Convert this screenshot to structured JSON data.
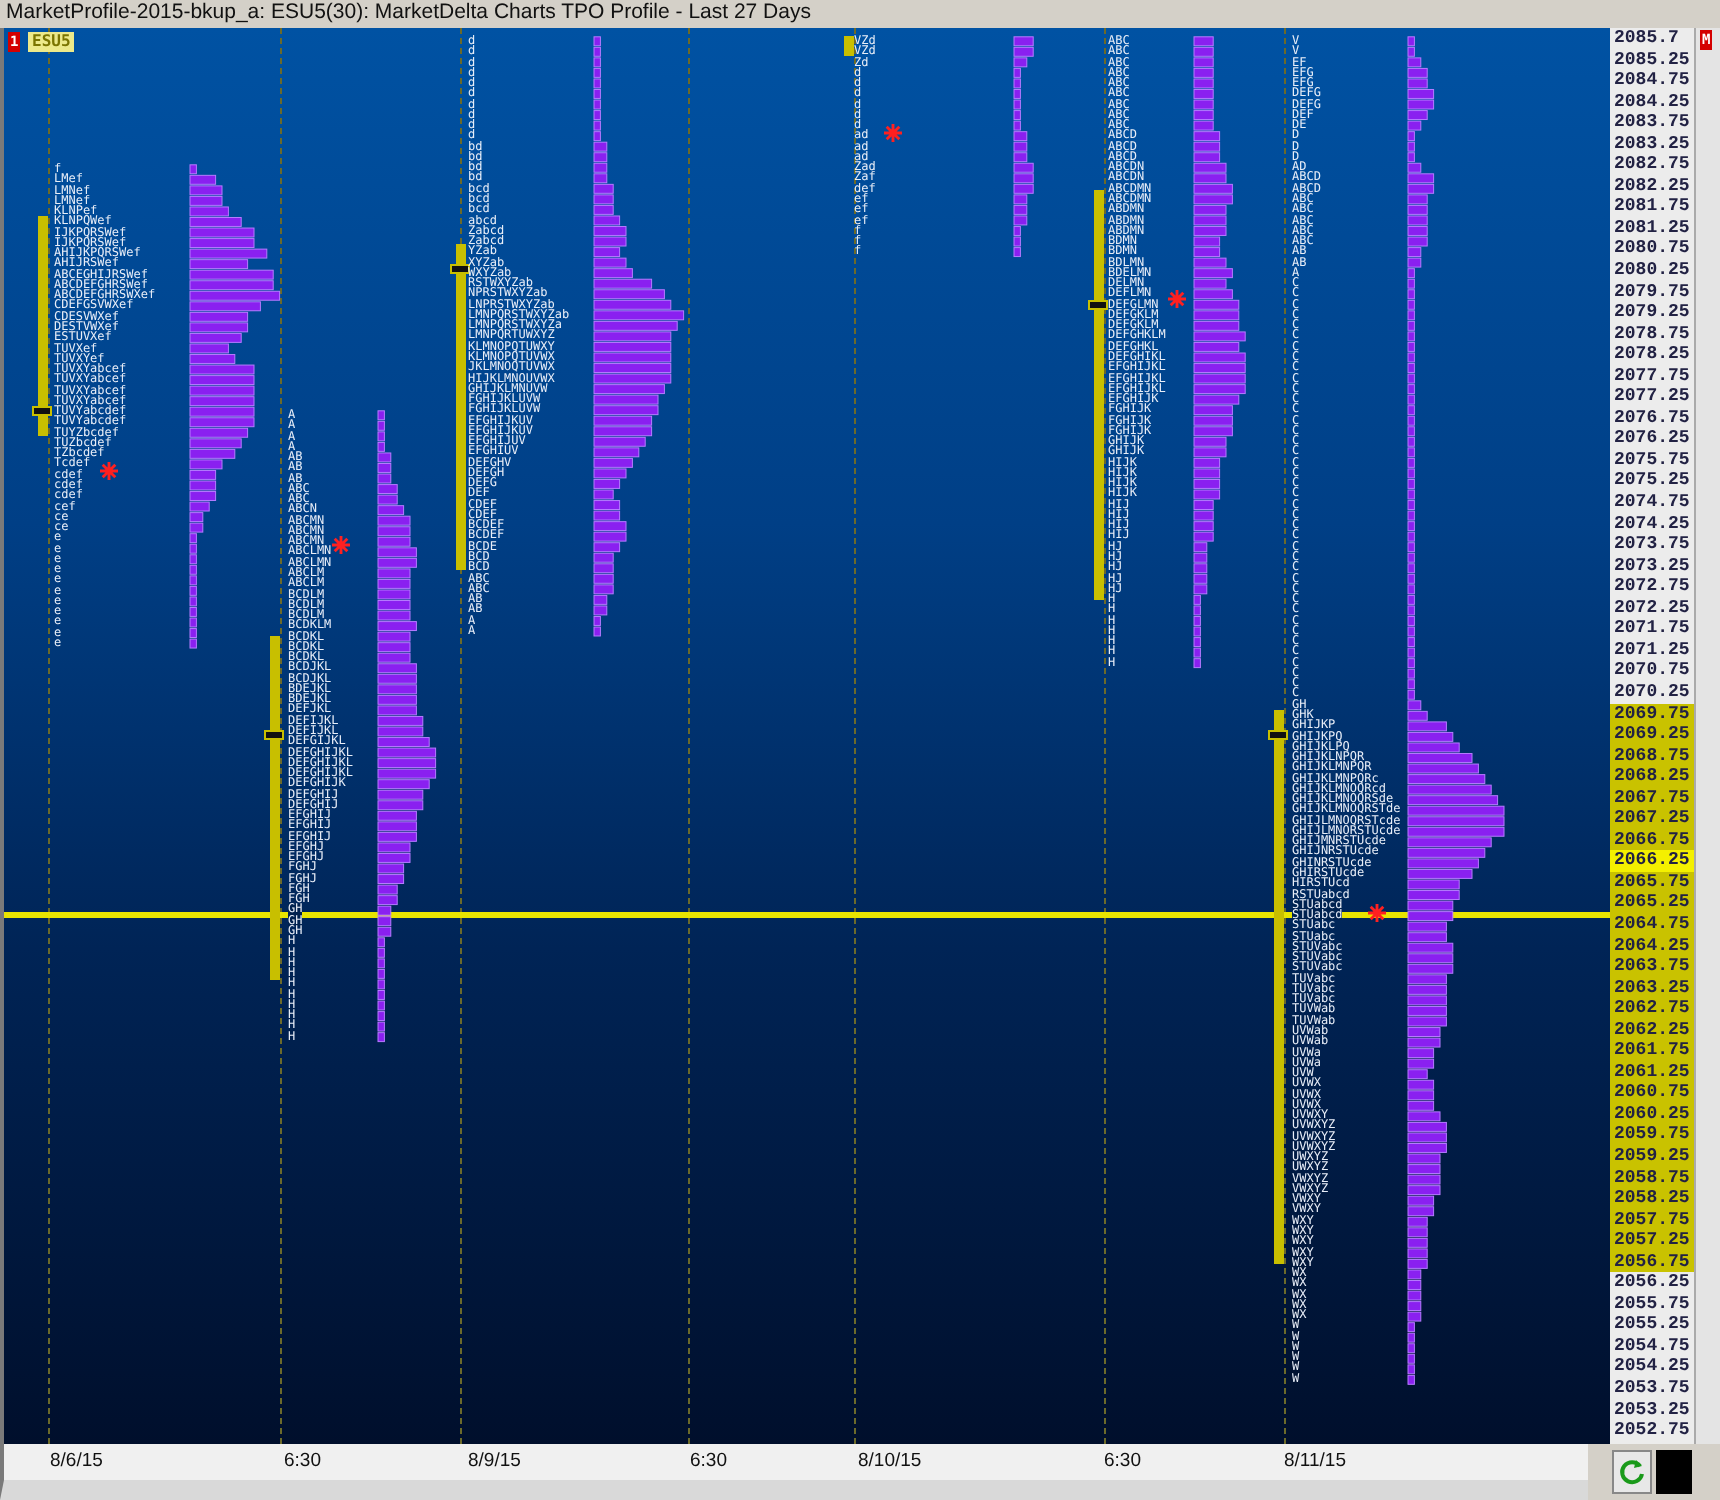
{
  "window": {
    "title": "MarketProfile-2015-bkup_a: ESU5(30): MarketDelta Charts TPO Profile - Last 27 Days"
  },
  "chart": {
    "window_badge": "1",
    "symbol": "ESU5",
    "profiles": [
      {
        "rows": [
          "f",
          "LMef",
          "LMNef",
          "LMNef",
          "KLNPef",
          "KLNPQWef",
          "IJKPQRSWef",
          "IJKPQRSWef",
          "AHIJKPQRSWef",
          "AHIJRSWef",
          "ABCEGHIJRSWef",
          "ABCDEFGHRSWef",
          "ABCDEFGHRSWXef",
          "CDEFGSVWXef",
          "CDESVWXef",
          "DESTVWXef",
          "ESTUVXef",
          "TUVXef",
          "TUVXYef",
          "TUVXYabcef",
          "TUVXYabcef",
          "TUVXYabcef",
          "TUVXYabcef",
          "TUVYabcdef",
          "TUVYabcdef",
          "TUYZbcdef",
          "TUZbcdef",
          "TZbcdef",
          "Tcdef",
          "cdef",
          "cdef",
          "cdef",
          "cef",
          "ce",
          "ce",
          "e",
          "e",
          "e",
          "e",
          "e",
          "e",
          "e",
          "e",
          "e",
          "e",
          "e"
        ]
      },
      {
        "rows": [
          "A",
          "A",
          "A",
          "A",
          "AB",
          "AB",
          "AB",
          "ABC",
          "ABC",
          "ABCN",
          "ABCMN",
          "ABCMN",
          "ABCMN",
          "ABCLMN",
          "ABCLMN",
          "ABCLM",
          "ABCLM",
          "BCDLM",
          "BCDLM",
          "BCDLM",
          "BCDKLM",
          "BCDKL",
          "BCDKL",
          "BCDKL",
          "BCDJKL",
          "BCDJKL",
          "BDEJKL",
          "BDEJKL",
          "DEFJKL",
          "DEFIJKL",
          "DEFIJKL",
          "DEFGIJKL",
          "DEFGHIJKL",
          "DEFGHIJKL",
          "DEFGHIJKL",
          "DEFGHIJK",
          "DEFGHIJ",
          "DEFGHIJ",
          "EFGHIJ",
          "EFGHIJ",
          "EFGHIJ",
          "EFGHJ",
          "EFGHJ",
          "FGHJ",
          "FGHJ",
          "FGH",
          "FGH",
          "GH",
          "GH",
          "GH",
          "H",
          "H",
          "H",
          "H",
          "H",
          "H",
          "H",
          "H",
          "H",
          "H"
        ]
      },
      {
        "rows": [
          "d",
          "d",
          "d",
          "d",
          "d",
          "d",
          "d",
          "d",
          "d",
          "d",
          "bd",
          "bd",
          "bd",
          "bd",
          "bcd",
          "bcd",
          "bcd",
          "abcd",
          "Zabcd",
          "Zabcd",
          "YZab",
          "XYZab",
          "WXYZab",
          "RSTWXYZab",
          "NPRSTWXYZab",
          "LNPRSTWXYZab",
          "LMNPQRSTWXYZab",
          "LMNPQRSTWXYZa",
          "LMNPQRTUWXYZ",
          "KLMNOPQTUWXY",
          "KLMNOPQTUVWX",
          "JKLMNOQTUVWX",
          "HIJKLMNOUVWX",
          "GHIJKLMNUVW",
          "FGHIJKLUVW",
          "FGHIJKLUVW",
          "EFGHIJKUV",
          "EFGHIJKUV",
          "EFGHIJUV",
          "EFGHIUV",
          "DEFGHV",
          "DEFGH",
          "DEFG",
          "DEF",
          "CDEF",
          "CDEF",
          "BCDEF",
          "BCDEF",
          "BCDE",
          "BCD",
          "BCD",
          "ABC",
          "ABC",
          "AB",
          "AB",
          "A",
          "A"
        ]
      },
      {
        "rows": [
          "VZd",
          "VZd",
          "Zd",
          "d",
          "d",
          "d",
          "d",
          "d",
          "d",
          "ad",
          "ad",
          "ad",
          "Zad",
          "Zaf",
          "def",
          "ef",
          "ef",
          "ef",
          "f",
          "f",
          "f"
        ]
      },
      {
        "rows": [
          "ABC",
          "ABC",
          "ABC",
          "ABC",
          "ABC",
          "ABC",
          "ABC",
          "ABC",
          "ABC",
          "ABCD",
          "ABCD",
          "ABCD",
          "ABCDN",
          "ABCDN",
          "ABCDMN",
          "ABCDMN",
          "ABDMN",
          "ABDMN",
          "ABDMN",
          "BDMN",
          "BDMN",
          "BDLMN",
          "BDELMN",
          "DELMN",
          "DEFLMN",
          "DEFGLMN",
          "DEFGKLM",
          "DEFGKLM",
          "DEFGHKLM",
          "DEFGHKL",
          "DEFGHIKL",
          "EFGHIJKL",
          "EFGHIJKL",
          "EFGHIJKL",
          "EFGHIJK",
          "FGHIJK",
          "FGHIJK",
          "FGHIJK",
          "GHIJK",
          "GHIJK",
          "HIJK",
          "HIJK",
          "HIJK",
          "HIJK",
          "HIJ",
          "HIJ",
          "HIJ",
          "HIJ",
          "HJ",
          "HJ",
          "HJ",
          "HJ",
          "HJ",
          "H",
          "H",
          "H",
          "H",
          "H",
          "H",
          "H"
        ]
      },
      {
        "rows": [
          "V",
          "V",
          "EF",
          "EFG",
          "EFG",
          "DEFG",
          "DEFG",
          "DEF",
          "DE",
          "D",
          "D",
          "D",
          "AD",
          "ABCD",
          "ABCD",
          "ABC",
          "ABC",
          "ABC",
          "ABC",
          "ABC",
          "AB",
          "AB",
          "A",
          "C",
          "C",
          "C",
          "C",
          "C",
          "C",
          "C",
          "C",
          "C",
          "C",
          "C",
          "C",
          "C",
          "C",
          "C",
          "C",
          "C",
          "C",
          "C",
          "C",
          "C",
          "C",
          "C",
          "C",
          "C",
          "C",
          "C",
          "C",
          "C",
          "C",
          "C",
          "C",
          "C",
          "C",
          "C",
          "C",
          "C",
          "C",
          "C",
          "C",
          "GH",
          "GHK",
          "GHIJKP",
          "GHIJKPQ",
          "GHIJKLPQ",
          "GHIJKLNPQR",
          "GHIJKLMNPQR",
          "GHIJKLMNPQRc",
          "GHIJKLMNOQRcd",
          "GHIJKLMNOQRSde",
          "GHIJKLMNOQRSTde",
          "GHIJLMNOQRSTcde",
          "GHIJLMNORSTUcde",
          "GHIJMNRSTUcde",
          "GHIJNRSTUcde",
          "GHINRSTUcde",
          "GHIRSTUcde",
          "HIRSTUcd",
          "RSTUabcd",
          "STUabcd",
          "STUabcd",
          "STUabc",
          "STUabc",
          "STUVabc",
          "STUVabc",
          "STUVabc",
          "TUVabc",
          "TUVabc",
          "TUVabc",
          "TUVWab",
          "TUVWab",
          "UVWab",
          "UVWab",
          "UVWa",
          "UVWa",
          "UVW",
          "UVWX",
          "UVWX",
          "UVWX",
          "UVWXY",
          "UVWXYZ",
          "UVWXYZ",
          "UVWXYZ",
          "UWXYZ",
          "UWXYZ",
          "VWXYZ",
          "VWXYZ",
          "VWXY",
          "VWXY",
          "WXY",
          "WXY",
          "WXY",
          "WXY",
          "WXY",
          "WX",
          "WX",
          "WX",
          "WX",
          "WX",
          "W",
          "W",
          "W",
          "W",
          "W",
          "W"
        ]
      }
    ]
  },
  "price_axis": {
    "corner_badge": "M",
    "labels": [
      {
        "text": "2085.7",
        "kind": "plain"
      },
      {
        "text": "2085.25",
        "kind": "plain"
      },
      {
        "text": "2084.75",
        "kind": "plain"
      },
      {
        "text": "2084.25",
        "kind": "plain"
      },
      {
        "text": "2083.75",
        "kind": "plain"
      },
      {
        "text": "2083.25",
        "kind": "plain"
      },
      {
        "text": "2082.75",
        "kind": "plain"
      },
      {
        "text": "2082.25",
        "kind": "plain"
      },
      {
        "text": "2081.75",
        "kind": "plain"
      },
      {
        "text": "2081.25",
        "kind": "plain"
      },
      {
        "text": "2080.75",
        "kind": "plain"
      },
      {
        "text": "2080.25",
        "kind": "plain"
      },
      {
        "text": "2079.75",
        "kind": "plain"
      },
      {
        "text": "2079.25",
        "kind": "plain"
      },
      {
        "text": "2078.75",
        "kind": "plain"
      },
      {
        "text": "2078.25",
        "kind": "plain"
      },
      {
        "text": "2077.75",
        "kind": "plain"
      },
      {
        "text": "2077.25",
        "kind": "plain"
      },
      {
        "text": "2076.75",
        "kind": "plain"
      },
      {
        "text": "2076.25",
        "kind": "plain"
      },
      {
        "text": "2075.75",
        "kind": "plain"
      },
      {
        "text": "2075.25",
        "kind": "plain"
      },
      {
        "text": "2074.75",
        "kind": "plain"
      },
      {
        "text": "2074.25",
        "kind": "plain"
      },
      {
        "text": "2073.75",
        "kind": "plain"
      },
      {
        "text": "2073.25",
        "kind": "plain"
      },
      {
        "text": "2072.75",
        "kind": "plain"
      },
      {
        "text": "2072.25",
        "kind": "plain"
      },
      {
        "text": "2071.75",
        "kind": "plain"
      },
      {
        "text": "2071.25",
        "kind": "plain"
      },
      {
        "text": "2070.75",
        "kind": "plain"
      },
      {
        "text": "2070.25",
        "kind": "plain"
      },
      {
        "text": "2069.75",
        "kind": "value_area"
      },
      {
        "text": "2069.25",
        "kind": "value_area"
      },
      {
        "text": "2068.75",
        "kind": "value_area"
      },
      {
        "text": "2068.25",
        "kind": "value_area"
      },
      {
        "text": "2067.75",
        "kind": "value_area"
      },
      {
        "text": "2067.25",
        "kind": "value_area"
      },
      {
        "text": "2066.75",
        "kind": "value_area"
      },
      {
        "text": "2066.25",
        "kind": "current"
      },
      {
        "text": "2065.75",
        "kind": "value_area"
      },
      {
        "text": "2065.25",
        "kind": "value_area"
      },
      {
        "text": "2064.75",
        "kind": "value_area"
      },
      {
        "text": "2064.25",
        "kind": "value_area"
      },
      {
        "text": "2063.75",
        "kind": "value_area"
      },
      {
        "text": "2063.25",
        "kind": "value_area"
      },
      {
        "text": "2062.75",
        "kind": "value_area"
      },
      {
        "text": "2062.25",
        "kind": "value_area"
      },
      {
        "text": "2061.75",
        "kind": "value_area"
      },
      {
        "text": "2061.25",
        "kind": "value_area"
      },
      {
        "text": "2060.75",
        "kind": "value_area"
      },
      {
        "text": "2060.25",
        "kind": "value_area"
      },
      {
        "text": "2059.75",
        "kind": "value_area"
      },
      {
        "text": "2059.25",
        "kind": "value_area"
      },
      {
        "text": "2058.75",
        "kind": "value_area"
      },
      {
        "text": "2058.25",
        "kind": "value_area"
      },
      {
        "text": "2057.75",
        "kind": "value_area"
      },
      {
        "text": "2057.25",
        "kind": "value_area"
      },
      {
        "text": "2056.75",
        "kind": "value_area"
      },
      {
        "text": "2056.25",
        "kind": "plain"
      },
      {
        "text": "2055.75",
        "kind": "plain"
      },
      {
        "text": "2055.25",
        "kind": "plain"
      },
      {
        "text": "2054.75",
        "kind": "plain"
      },
      {
        "text": "2054.25",
        "kind": "plain"
      },
      {
        "text": "2053.75",
        "kind": "plain"
      },
      {
        "text": "2053.25",
        "kind": "plain"
      },
      {
        "text": "2052.75",
        "kind": "plain"
      }
    ]
  },
  "time_axis": {
    "labels": [
      "8/6/15",
      "6:30",
      "8/9/15",
      "6:30",
      "8/10/15",
      "6:30",
      "8/11/15"
    ]
  }
}
